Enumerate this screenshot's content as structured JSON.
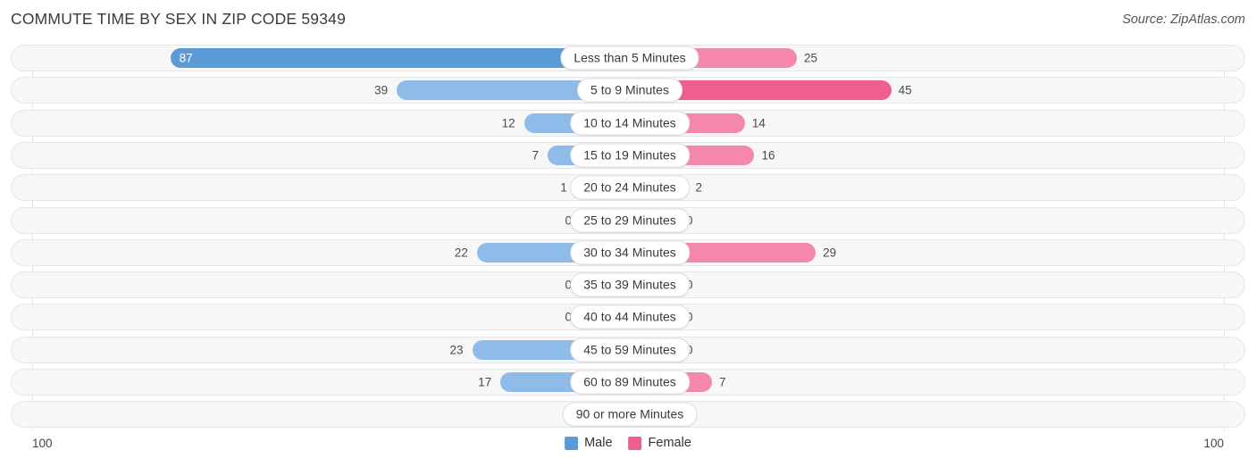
{
  "header": {
    "title": "COMMUTE TIME BY SEX IN ZIP CODE 59349",
    "source": "Source: ZipAtlas.com"
  },
  "axis": {
    "left_end_label": "100",
    "right_end_label": "100"
  },
  "legend": {
    "items": [
      {
        "label": "Male",
        "color": "#5b9bd5"
      },
      {
        "label": "Female",
        "color": "#ef5f8d"
      }
    ]
  },
  "colors": {
    "male_strong": "#5b9bd5",
    "male_light": "#8fbbe8",
    "female_strong": "#ef5f8d",
    "female_light": "#f487ad",
    "track_fill": "#f7f7f7",
    "track_border": "#e6e6e6",
    "gridline": "#e2e2e2"
  },
  "chart_data": {
    "type": "bar",
    "orientation": "horizontal-diverging",
    "title": "COMMUTE TIME BY SEX IN ZIP CODE 59349",
    "xlabel": "",
    "ylabel": "",
    "xlim": [
      100,
      100
    ],
    "grid": true,
    "legend_position": "bottom-center",
    "categories": [
      "Less than 5 Minutes",
      "5 to 9 Minutes",
      "10 to 14 Minutes",
      "15 to 19 Minutes",
      "20 to 24 Minutes",
      "25 to 29 Minutes",
      "30 to 34 Minutes",
      "35 to 39 Minutes",
      "40 to 44 Minutes",
      "45 to 59 Minutes",
      "60 to 89 Minutes",
      "90 or more Minutes"
    ],
    "series": [
      {
        "name": "Male",
        "side": "left",
        "values": [
          87,
          39,
          12,
          7,
          1,
          0,
          22,
          0,
          0,
          23,
          17,
          0
        ],
        "labels": [
          "87",
          "39",
          "12",
          "7",
          "1",
          "0",
          "22",
          "0",
          "0",
          "23",
          "17",
          "0"
        ]
      },
      {
        "name": "Female",
        "side": "right",
        "values": [
          25,
          45,
          14,
          16,
          2,
          0,
          29,
          0,
          0,
          0,
          7,
          0
        ],
        "labels": [
          "25",
          "45",
          "14",
          "16",
          "2",
          "0",
          "29",
          "0",
          "0",
          "0",
          "7",
          "0"
        ]
      }
    ]
  }
}
